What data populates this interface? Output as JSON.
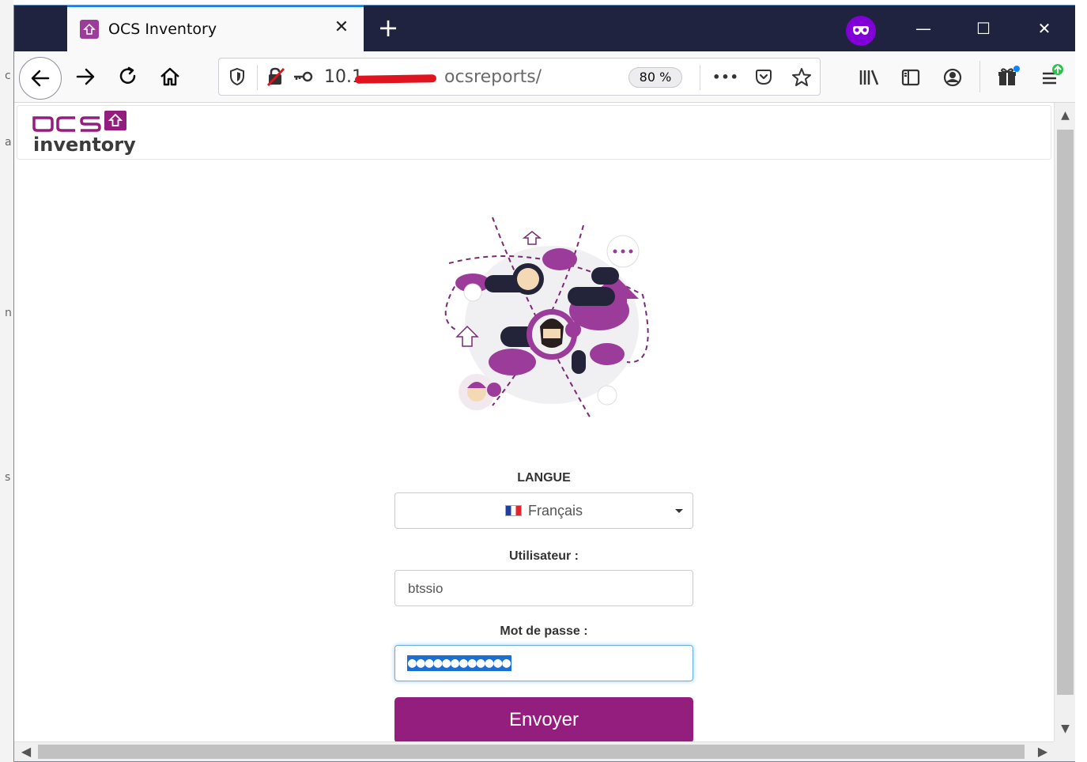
{
  "tab": {
    "title": "OCS Inventory",
    "close": "✕",
    "new_tab": "+"
  },
  "window": {
    "minimize": "—",
    "maximize": "☐",
    "close": "✕"
  },
  "address_bar": {
    "url_visible_start": "10.1",
    "url_visible_end": "ocsreports/",
    "zoom": "80 %",
    "more": "•••"
  },
  "page": {
    "logo_top": "ocs",
    "logo_bottom": "inventory",
    "language": {
      "label": "LANGUE",
      "selected": "Français"
    },
    "username": {
      "label": "Utilisateur :",
      "value": "btssio"
    },
    "password": {
      "label": "Mot de passe :",
      "value": "●●●●●●●●●●●●"
    },
    "submit": "Envoyer"
  },
  "left_edge_letters": [
    "c",
    "a",
    "n",
    "s"
  ],
  "colors": {
    "brand": "#941e7e",
    "titlebar": "#202340",
    "focus": "#66afe9",
    "private": "#8000d7"
  }
}
